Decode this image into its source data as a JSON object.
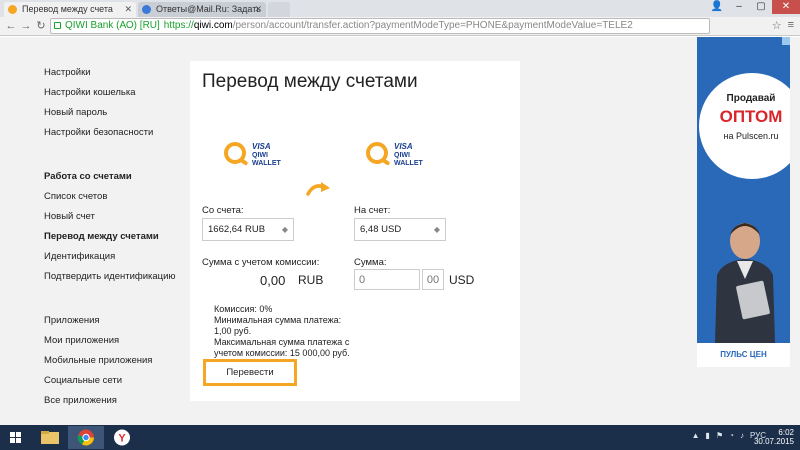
{
  "browser": {
    "tabs": [
      {
        "title": "Перевод между счета",
        "active": true
      },
      {
        "title": "Ответы@Mail.Ru: Задать",
        "active": false
      }
    ],
    "ev_label": "QIWI Bank (АО) [RU]",
    "url_scheme": "https://",
    "url_host": "qiwi.com",
    "url_path": "/person/account/transfer.action?paymentModeType=PHONE&paymentModeValue=TELE2"
  },
  "sidebar": {
    "group1": [
      "Настройки",
      "Настройки кошелька",
      "Новый пароль",
      "Настройки безопасности"
    ],
    "group2": [
      "Работа со счетами",
      "Список счетов",
      "Новый счет",
      "Перевод между счетами",
      "Идентификация",
      "Подтвердить идентификацию"
    ],
    "group3": [
      "Приложения",
      "Мои приложения",
      "Мобильные приложения",
      "Социальные сети",
      "Все приложения"
    ]
  },
  "transfer": {
    "title": "Перевод между счетами",
    "logo": {
      "visa": "VISA",
      "qiwi": "QIWI",
      "wallet": "WALLET"
    },
    "from_label": "Со счета:",
    "from_value": "1662,64 RUB",
    "to_label": "На счет:",
    "to_value": "6,48 USD",
    "commission_amount_label": "Сумма с учетом комиссии:",
    "commission_amount_value": "0,00",
    "commission_currency": "RUB",
    "sum_label": "Сумма:",
    "sum_major_placeholder": "0",
    "sum_minor_placeholder": "00",
    "sum_currency": "USD",
    "info": [
      "Комиссия: 0%",
      "Минимальная сумма платежа: 1,00 руб.",
      "Максимальная сумма платежа с учетом комиссии: 15 000,00 руб."
    ],
    "submit_label": "Перевести"
  },
  "ad": {
    "line1": "Продавай",
    "line2": "ОПТОМ",
    "line3": "на Pulscen.ru",
    "footer": "ПУЛЬС ЦЕН"
  },
  "taskbar": {
    "lang": "РУС",
    "time": "6:02",
    "date": "30.07.2015"
  },
  "colors": {
    "accent": "#f5a623",
    "brand_blue": "#1a3f8f",
    "ev_green": "#19a12c",
    "ad_blue": "#2a69b8",
    "ad_red": "#d9262c"
  }
}
